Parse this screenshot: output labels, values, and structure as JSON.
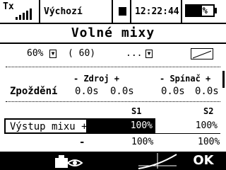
{
  "status": {
    "tx_label": "Tx",
    "signal_bars": 5,
    "model_name": "Výchozí",
    "clock": "12:22:44",
    "battery_text": "57%",
    "battery_level": 0.57
  },
  "title": "Volné mixy",
  "mix_row": {
    "percent": "60%",
    "value": "( 60)",
    "dots": "..."
  },
  "headers": {
    "source": "- Zdroj +",
    "switch": "- Spínač +"
  },
  "delay": {
    "label": "Zpoždění",
    "values": [
      "0.0s",
      "0.0s",
      "0.0s",
      "0.0s"
    ]
  },
  "output": {
    "col_labels": [
      "S1",
      "S2"
    ],
    "label": "Výstup mixu +",
    "row1": [
      "100%",
      "100%"
    ],
    "row2_sign": "-",
    "row2": [
      "100%",
      "100%"
    ]
  },
  "bottom": {
    "ok_label": "OK"
  },
  "colors": {
    "foreground": "#000000",
    "background": "#ffffff"
  }
}
